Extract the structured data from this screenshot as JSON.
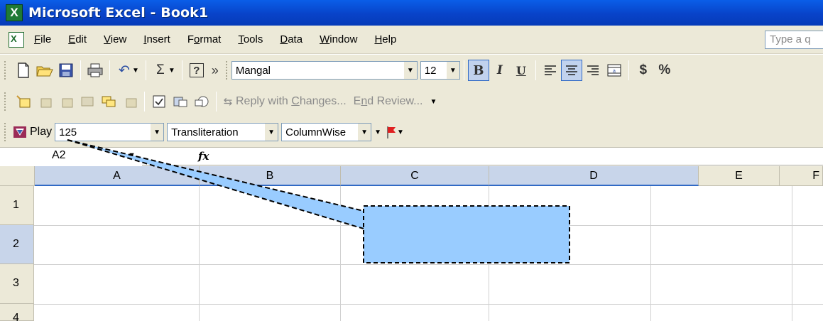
{
  "window": {
    "title": "Microsoft Excel - Book1",
    "app_icon_glyph": "X"
  },
  "menu": {
    "items": [
      {
        "label_pre": "",
        "ul": "F",
        "label_post": "ile"
      },
      {
        "label_pre": "",
        "ul": "E",
        "label_post": "dit"
      },
      {
        "label_pre": "",
        "ul": "V",
        "label_post": "iew"
      },
      {
        "label_pre": "",
        "ul": "I",
        "label_post": "nsert"
      },
      {
        "label_pre": "F",
        "ul": "o",
        "label_post": "rmat"
      },
      {
        "label_pre": "",
        "ul": "T",
        "label_post": "ools"
      },
      {
        "label_pre": "",
        "ul": "D",
        "label_post": "ata"
      },
      {
        "label_pre": "",
        "ul": "W",
        "label_post": "indow"
      },
      {
        "label_pre": "",
        "ul": "H",
        "label_post": "elp"
      }
    ],
    "help_placeholder": "Type a q"
  },
  "standard_toolbar": {
    "font_name": "Mangal",
    "font_size": "12",
    "bold": "B",
    "italic": "I",
    "underline": "U",
    "currency": "$",
    "percent": "%",
    "sum": "Σ",
    "more": "»",
    "help": "?"
  },
  "reviewing_toolbar": {
    "reply_pre": "Reply with ",
    "reply_ul": "C",
    "reply_post": "hanges...",
    "end_pre": "E",
    "end_ul": "n",
    "end_post": "d Review..."
  },
  "custom_toolbar": {
    "play_label": "Play",
    "speed_value": "125",
    "mode_value": "Transliteration",
    "direction_value": "ColumnWise"
  },
  "formula_bar": {
    "name_box": "A2",
    "fx_label": "fx",
    "formula": ""
  },
  "grid": {
    "columns": [
      "A",
      "B",
      "C",
      "D",
      "E",
      "F"
    ],
    "rows": [
      "1",
      "2",
      "3",
      "4"
    ],
    "selected_cell": "A2"
  },
  "colors": {
    "titlebar": "#0a5ee8",
    "chrome": "#ece9d8",
    "selection_header": "#c8d5ea",
    "callout_fill": "#99ccff"
  }
}
